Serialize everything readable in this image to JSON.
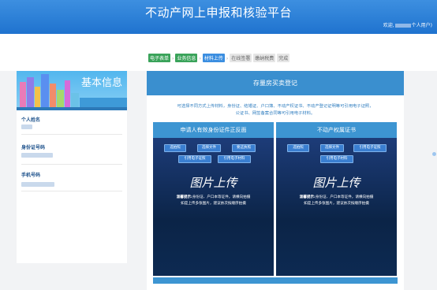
{
  "header": {
    "title": "不动产网上申报和核验平台",
    "welcome_prefix": "欢迎,",
    "welcome_suffix": "个人用户)"
  },
  "steps": [
    {
      "label": "电子表单",
      "state": "done"
    },
    {
      "label": "业务信息",
      "state": "done"
    },
    {
      "label": "材料上传",
      "state": "current"
    },
    {
      "label": "在线签署",
      "state": "pending"
    },
    {
      "label": "缴纳税费",
      "state": "pending"
    },
    {
      "label": "完成",
      "state": "pending"
    }
  ],
  "sidebar": {
    "banner_title": "基本信息",
    "name_label": "个人姓名",
    "id_label": "身份证号码",
    "phone_label": "手机号码"
  },
  "main": {
    "title": "存量房买卖登记",
    "notice_line1": "可选择不同方式上传材料，身份证、结婚证、户口簿、不动产权证书、不动产登记证明等可引用电子证照，",
    "notice_line2": "公证书、网签备案合同等可引用电子材料。",
    "panels": [
      {
        "title": "申请人有效身份证件正反面",
        "buttons_row1": [
          "选拍照",
          "选择文件",
          "要这执照"
        ],
        "buttons_row2": [
          "引用电子证照",
          "引用电子材料"
        ],
        "upload_text": "图片上传",
        "tip_label": "温馨提示:",
        "tip_line1": "身份证、户口本等证件，请横向拍摄",
        "tip_line2": "如是上传多张图片，建议依次按顺序拍摄"
      },
      {
        "title": "不动产权属证书",
        "buttons_row1": [
          "选拍照",
          "选择文件",
          "引用电子证照"
        ],
        "buttons_row2": [
          "引用电子材料"
        ],
        "upload_text": "图片上传",
        "tip_label": "温馨提示:",
        "tip_line1": "身份证、户口本等证件，请横向拍摄",
        "tip_line2": "如是上传多张图片，建议依次按顺序拍摄"
      }
    ]
  },
  "colors": {
    "header_blue": "#2a7fd8",
    "panel_dark": "#0b2447",
    "step_done": "#3aa35a",
    "step_current": "#3b8ee0"
  }
}
